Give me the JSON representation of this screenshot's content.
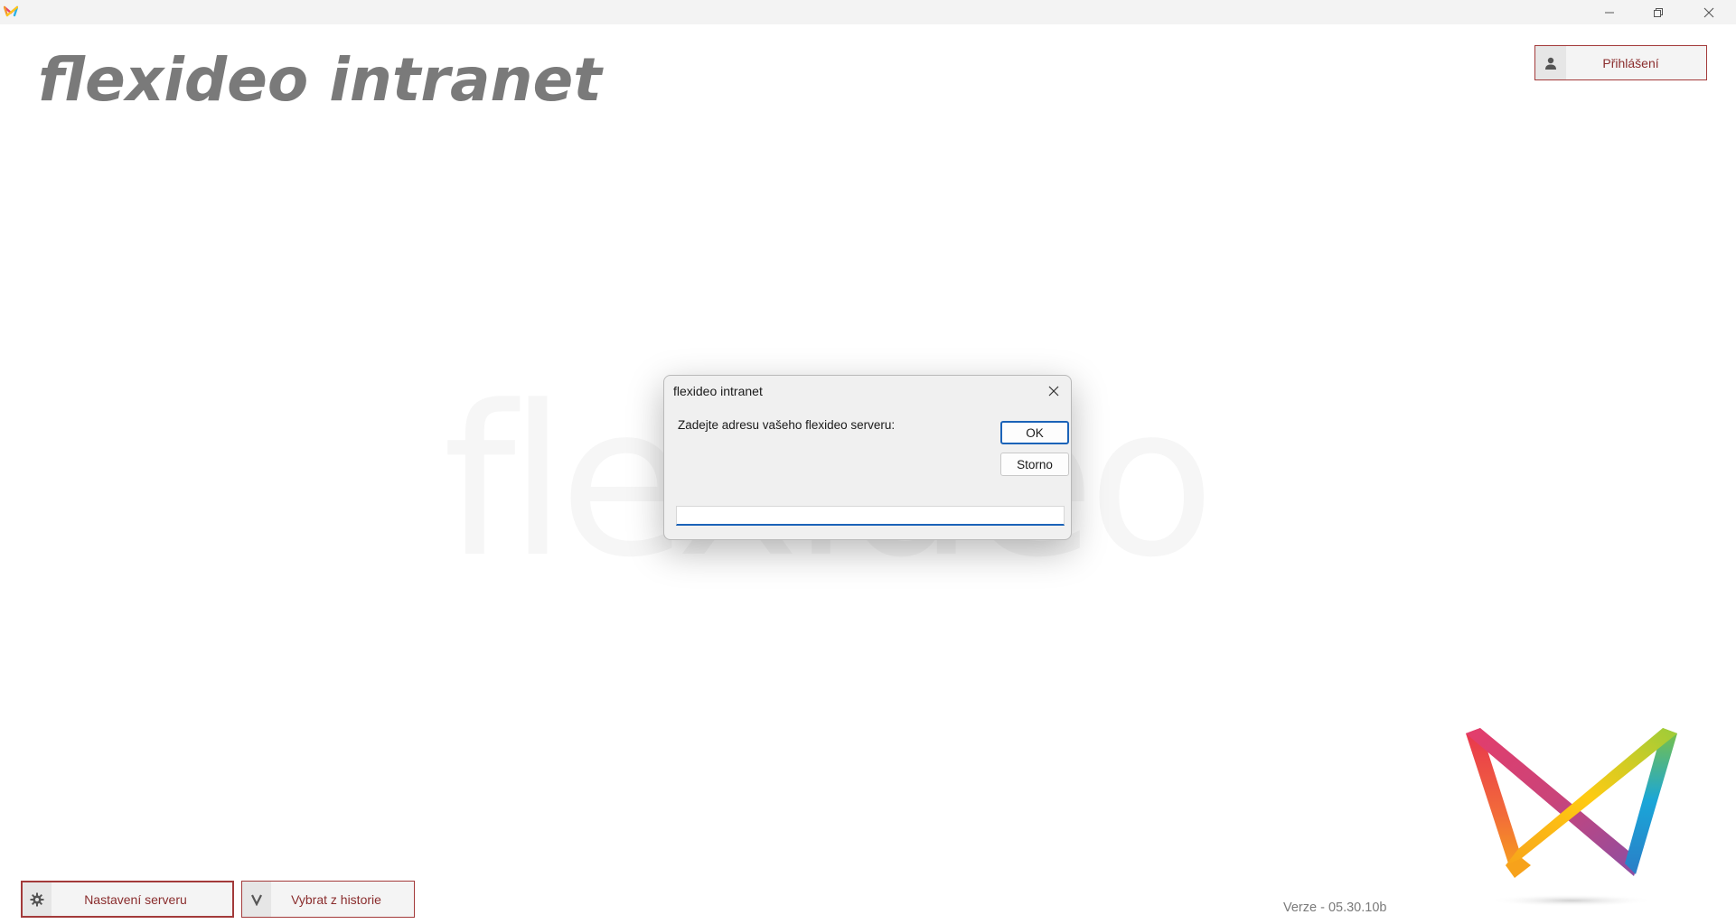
{
  "window": {
    "icon": "flexideo-logo-icon",
    "controls": {
      "minimize": "minimize-icon",
      "maximize": "restore-icon",
      "close": "close-icon"
    }
  },
  "header": {
    "title": "flexideo intranet",
    "login_label": "Přihlášení",
    "login_icon": "user-icon"
  },
  "watermark": {
    "text": "flexideo"
  },
  "dialog": {
    "title": "flexideo intranet",
    "prompt": "Zadejte adresu vašeho flexideo serveru:",
    "ok_label": "OK",
    "cancel_label": "Storno",
    "input_value": ""
  },
  "footer": {
    "server_settings_label": "Nastavení serveru",
    "server_settings_icon": "gear-icon",
    "history_label": "Vybrat z historie",
    "history_icon": "chevron-down-icon",
    "version": "Verze - 05.30.10b"
  },
  "colors": {
    "accent_border": "#a33a3a",
    "accent_text": "#8a2d2d",
    "focus_blue": "#1b63b8",
    "brand_gray": "#7a7a7a"
  }
}
